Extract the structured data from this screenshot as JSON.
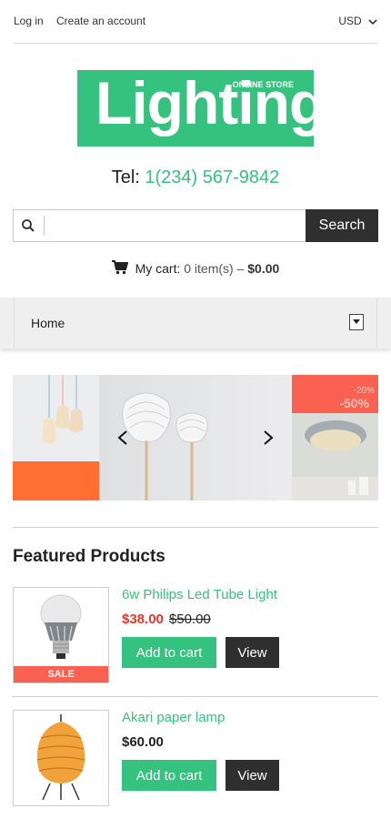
{
  "topbar": {
    "login": "Log in",
    "create_account": "Create an account",
    "currency": "USD"
  },
  "logo": {
    "word": "Lighting",
    "tagline": "ONLINE STORE"
  },
  "phone": {
    "label": "Tel:",
    "number": "1(234) 567-9842"
  },
  "search": {
    "placeholder": "",
    "button": "Search"
  },
  "cart": {
    "label": "My cart:",
    "items": "0 item(s)",
    "separator": " – ",
    "total": "$0.00"
  },
  "menu": {
    "home": "Home"
  },
  "slider": {
    "badge_small": "-20%",
    "badge_large": "-50%"
  },
  "featured": {
    "title": "Featured Products"
  },
  "products": [
    {
      "name": "6w Philips Led Tube Light",
      "price": "$38.00",
      "old_price": "$50.00",
      "badge": "SALE",
      "add": "Add to cart",
      "view": "View"
    },
    {
      "name": "Akari paper lamp",
      "price": "$60.00",
      "add": "Add to cart",
      "view": "View"
    }
  ],
  "colors": {
    "accent": "#35c27f",
    "dark": "#2f2f2f",
    "sale": "#fa6150",
    "price_sale": "#e8362e"
  }
}
